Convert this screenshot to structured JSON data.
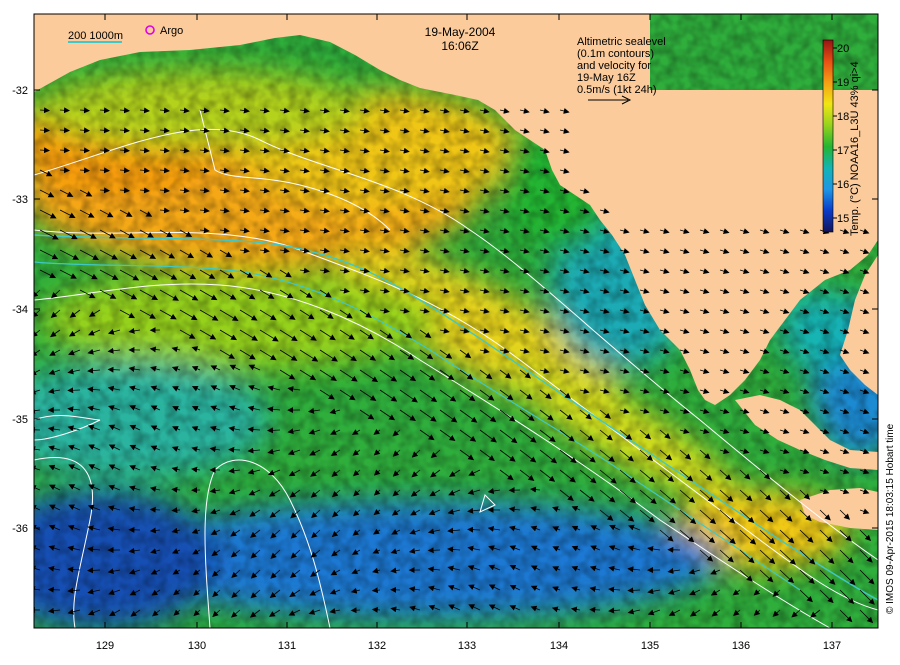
{
  "map": {
    "date": "19-May-2004",
    "time": "16:06Z",
    "legend_depth_label": "200  1000m",
    "legend_argo_label": "Argo",
    "note_lines": [
      "Altimetric sealevel",
      "(0.1m contours)",
      "and velocity for",
      "19-May 16Z",
      "0.5m/s (1kt 24h)"
    ],
    "x_ticks": [
      "129",
      "130",
      "131",
      "132",
      "133",
      "134",
      "135",
      "136",
      "137"
    ],
    "y_ticks": [
      "-32",
      "-33",
      "-34",
      "-35",
      "-36"
    ],
    "colorbar": {
      "title": "Temp. (°C) NOAA16_L3U 43% qi>4",
      "ticks": [
        "15",
        "16",
        "17",
        "18",
        "19",
        "20"
      ],
      "colors": [
        "#14145a",
        "#0a3cc8",
        "#1e96e6",
        "#14b4b4",
        "#23b432",
        "#96d21e",
        "#f0e614",
        "#f5a014",
        "#e65014",
        "#961414"
      ]
    },
    "credit": "© IMOS 09-Apr-2015 18:03:15 Hobart time",
    "colors": {
      "land": "#fbcb9b",
      "warm_sst": "#f5b814",
      "mid_sst": "#3cb43c",
      "cool_sst": "#1e7ad2",
      "contour": "#ffffff",
      "depth_200": "#40c8c8",
      "argo_marker": "#e000e0"
    }
  }
}
